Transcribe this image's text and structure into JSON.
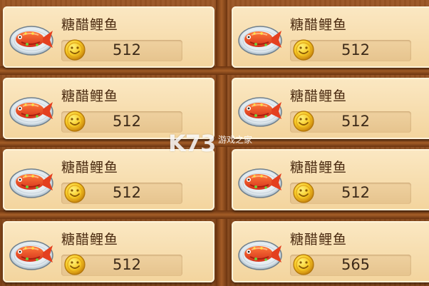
{
  "colors": {
    "frame": "#8a4a1f",
    "card": "#fbe8c3",
    "price_text": "#3d2a18",
    "coin": "#f6c824"
  },
  "items": [
    {
      "name": "糖醋鲤鱼",
      "price": "512",
      "icon": "fish-dish-icon",
      "currency_icon": "gold-coin-icon"
    },
    {
      "name": "糖醋鲤鱼",
      "price": "512",
      "icon": "fish-dish-icon",
      "currency_icon": "gold-coin-icon"
    },
    {
      "name": "糖醋鲤鱼",
      "price": "512",
      "icon": "fish-dish-icon",
      "currency_icon": "gold-coin-icon"
    },
    {
      "name": "糖醋鲤鱼",
      "price": "512",
      "icon": "fish-dish-icon",
      "currency_icon": "gold-coin-icon"
    },
    {
      "name": "糖醋鲤鱼",
      "price": "512",
      "icon": "fish-dish-icon",
      "currency_icon": "gold-coin-icon"
    },
    {
      "name": "糖醋鲤鱼",
      "price": "512",
      "icon": "fish-dish-icon",
      "currency_icon": "gold-coin-icon"
    },
    {
      "name": "糖醋鲤鱼",
      "price": "512",
      "icon": "fish-dish-icon",
      "currency_icon": "gold-coin-icon"
    },
    {
      "name": "糖醋鲤鱼",
      "price": "565",
      "icon": "fish-dish-icon",
      "currency_icon": "gold-coin-icon"
    }
  ],
  "watermark": {
    "logo": "K73",
    "text": "游戏之家"
  }
}
